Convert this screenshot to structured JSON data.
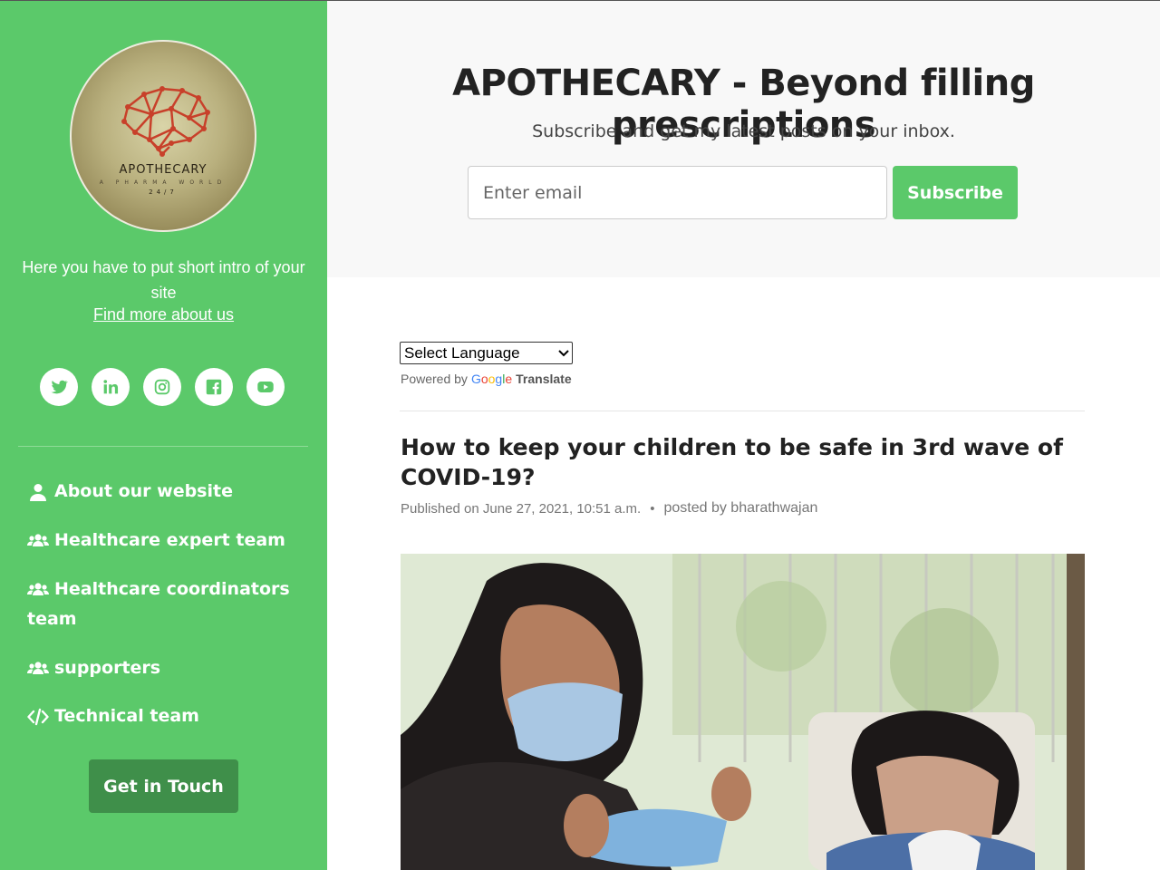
{
  "sidebar": {
    "logo": {
      "name": "APOTHECARY",
      "tagline": "A PHARMA WORLD",
      "hours": "24/7"
    },
    "intro": "Here you have to put short intro of your site",
    "find_more": "Find more about us",
    "socials": [
      "twitter-icon",
      "linkedin-icon",
      "instagram-icon",
      "facebook-icon",
      "youtube-icon"
    ],
    "nav": [
      {
        "label": "About our website",
        "icon": "user-icon"
      },
      {
        "label": "Healthcare expert team",
        "icon": "users-icon"
      },
      {
        "label": "Healthcare coordinators team",
        "icon": "users-icon"
      },
      {
        "label": "supporters",
        "icon": "users-icon"
      },
      {
        "label": "Technical team",
        "icon": "code-icon"
      }
    ],
    "cta": "Get in Touch"
  },
  "header": {
    "title": "APOTHECARY - Beyond filling prescriptions",
    "subtitle": "Subscribe and get my latest posts on your inbox.",
    "email_placeholder": "Enter email",
    "subscribe": "Subscribe"
  },
  "translate": {
    "select_label": "Select Language",
    "powered_by": "Powered by",
    "google": "Google",
    "translate": "Translate"
  },
  "post": {
    "title": "How to keep your children to be safe in 3rd wave of COVID-19?",
    "published": "Published on June 27, 2021, 10:51 a.m.",
    "author": "posted by bharathwajan"
  },
  "colors": {
    "sidebar_green": "#5bc96a",
    "cta_green": "#3f8f4a",
    "header_bg": "#f8f8f8"
  }
}
